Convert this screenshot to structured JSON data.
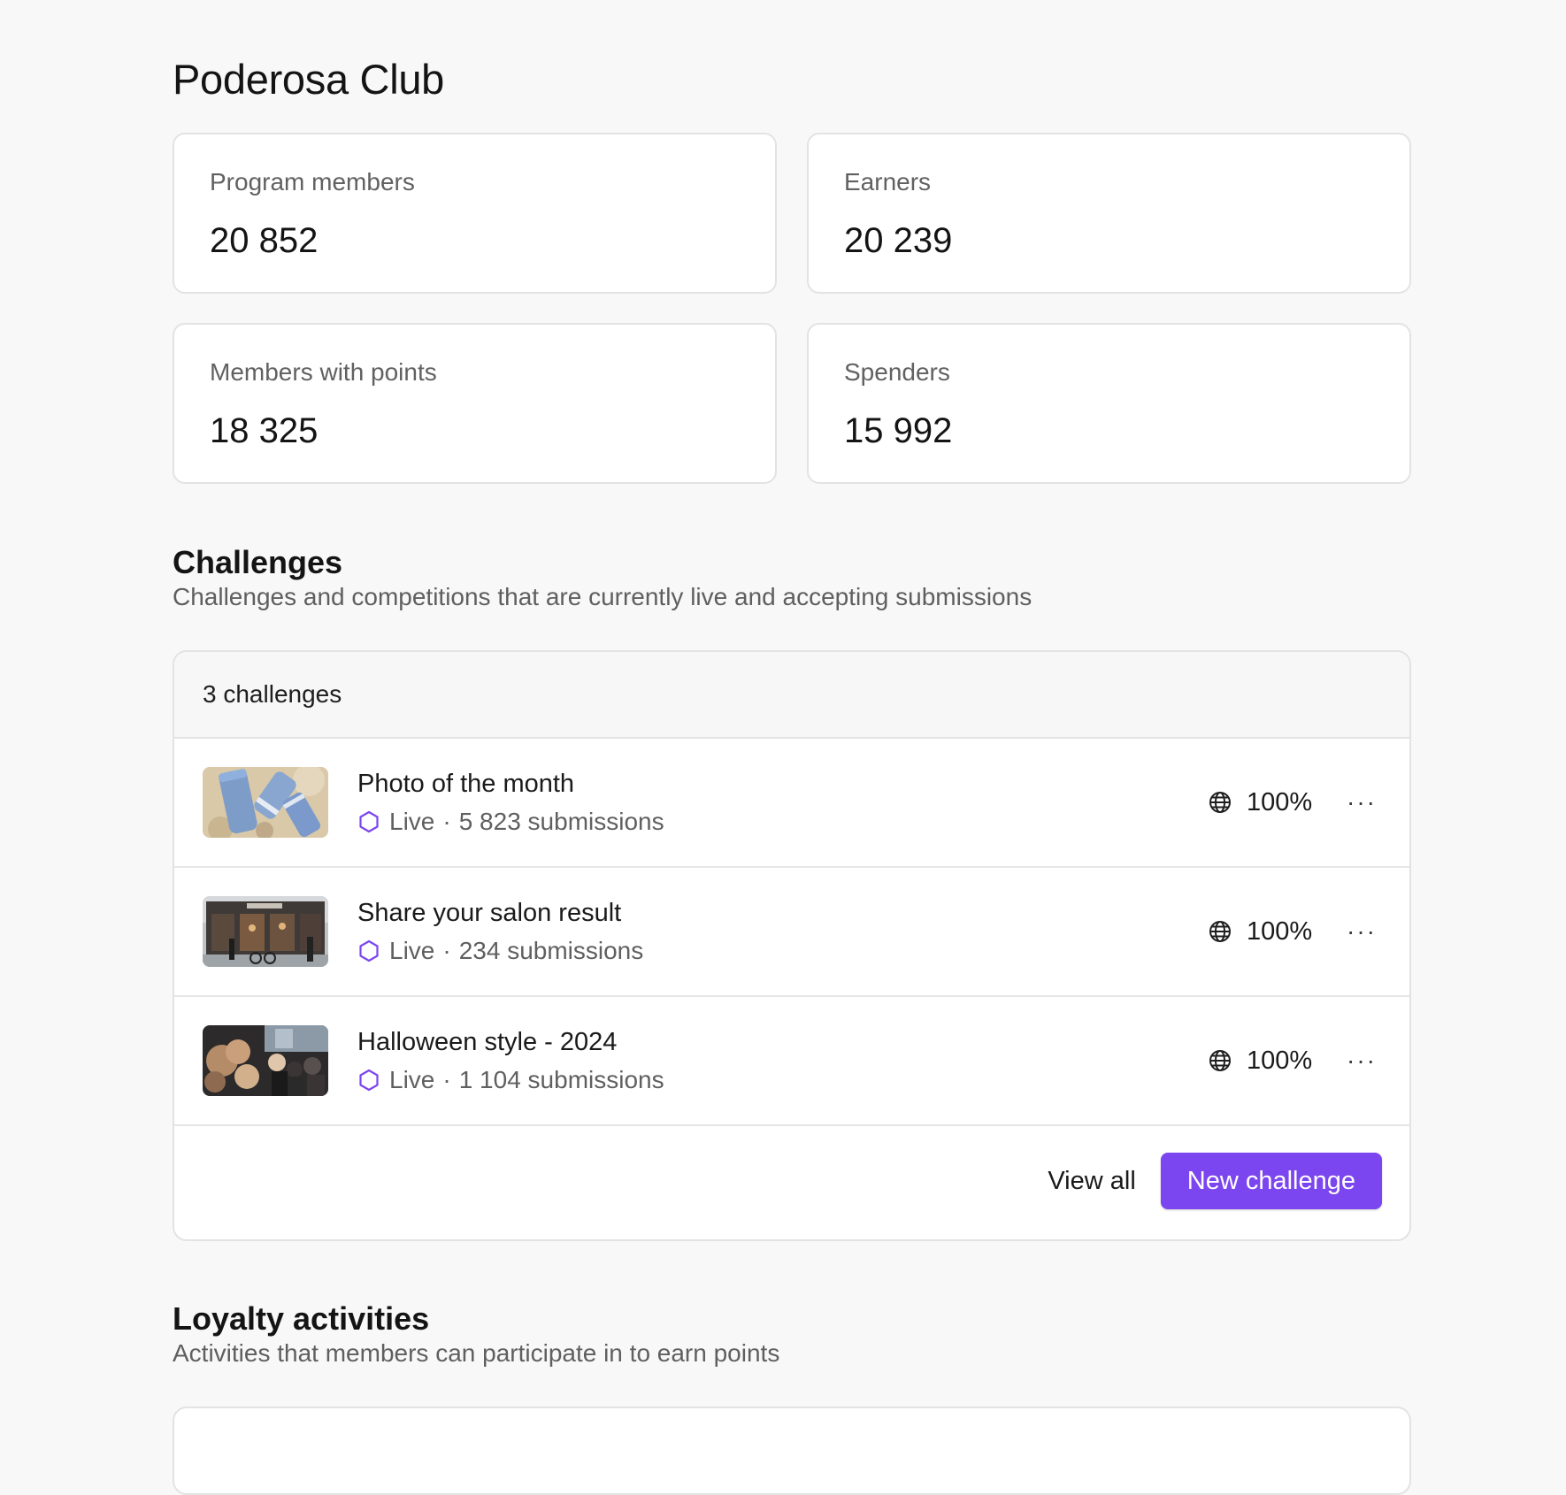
{
  "page": {
    "title": "Poderosa Club"
  },
  "stats": [
    {
      "label": "Program members",
      "value": "20 852"
    },
    {
      "label": "Earners",
      "value": "20 239"
    },
    {
      "label": "Members with points",
      "value": "18 325"
    },
    {
      "label": "Spenders",
      "value": "15 992"
    }
  ],
  "challenges": {
    "title": "Challenges",
    "subtitle": "Challenges and competitions that are currently live and accepting submissions",
    "count_label": "3 challenges",
    "items": [
      {
        "title": "Photo of the month",
        "status": "Live",
        "separator": "·",
        "submissions": "5 823 submissions",
        "visibility": "100%",
        "thumbnail": "product-photo-thumbnail"
      },
      {
        "title": "Share your salon result",
        "status": "Live",
        "separator": "·",
        "submissions": "234 submissions",
        "visibility": "100%",
        "thumbnail": "salon-storefront-thumbnail"
      },
      {
        "title": "Halloween style - 2024",
        "status": "Live",
        "separator": "·",
        "submissions": "1 104 submissions",
        "visibility": "100%",
        "thumbnail": "halloween-crowd-thumbnail"
      }
    ],
    "view_all_label": "View all",
    "new_button_label": "New challenge",
    "more_label": "···"
  },
  "loyalty": {
    "title": "Loyalty activities",
    "subtitle": "Activities that members can participate in to earn points"
  },
  "colors": {
    "accent": "#7b45ef",
    "status_icon": "#7b45ef",
    "background": "#f8f8f8",
    "card_border": "#e3e3e3"
  },
  "icons": {
    "status": "hexagon-icon",
    "visibility": "globe-icon",
    "more": "more-horizontal-icon"
  }
}
